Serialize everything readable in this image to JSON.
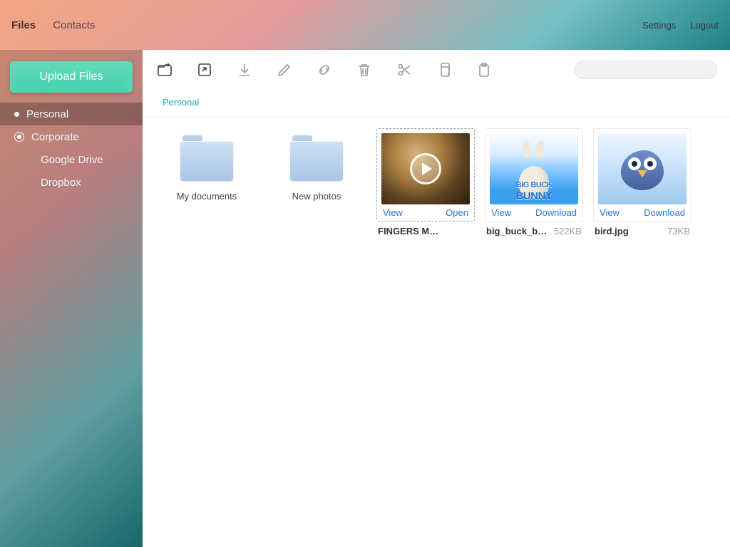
{
  "topnav": {
    "tabs": [
      "Files",
      "Contacts"
    ],
    "active": 0,
    "links": [
      "Settings",
      "Logout"
    ]
  },
  "sidebar": {
    "upload_label": "Upload Files",
    "items": [
      {
        "label": "Personal",
        "type": "dot",
        "active": true
      },
      {
        "label": "Corporate",
        "type": "radio",
        "active": false
      },
      {
        "label": "Google Drive",
        "type": "child",
        "active": false
      },
      {
        "label": "Dropbox",
        "type": "child",
        "active": false
      }
    ]
  },
  "toolbar": {
    "icons": [
      "new-folder",
      "share",
      "download",
      "rename",
      "link",
      "trash",
      "cut",
      "copy",
      "paste"
    ]
  },
  "search": {
    "placeholder": "",
    "value": ""
  },
  "breadcrumb": {
    "items": [
      "Personal"
    ]
  },
  "folders": [
    {
      "name": "My documents"
    },
    {
      "name": "New photos"
    }
  ],
  "files": [
    {
      "name": "FINGERS Mitchell C…",
      "size": "",
      "kind": "video",
      "selected": true,
      "actions": [
        "View",
        "Open"
      ]
    },
    {
      "name": "big_buck_bu…",
      "size": "522KB",
      "kind": "bunny",
      "selected": false,
      "actions": [
        "View",
        "Download"
      ]
    },
    {
      "name": "bird.jpg",
      "size": "73KB",
      "kind": "bird",
      "selected": false,
      "actions": [
        "View",
        "Download"
      ]
    }
  ]
}
